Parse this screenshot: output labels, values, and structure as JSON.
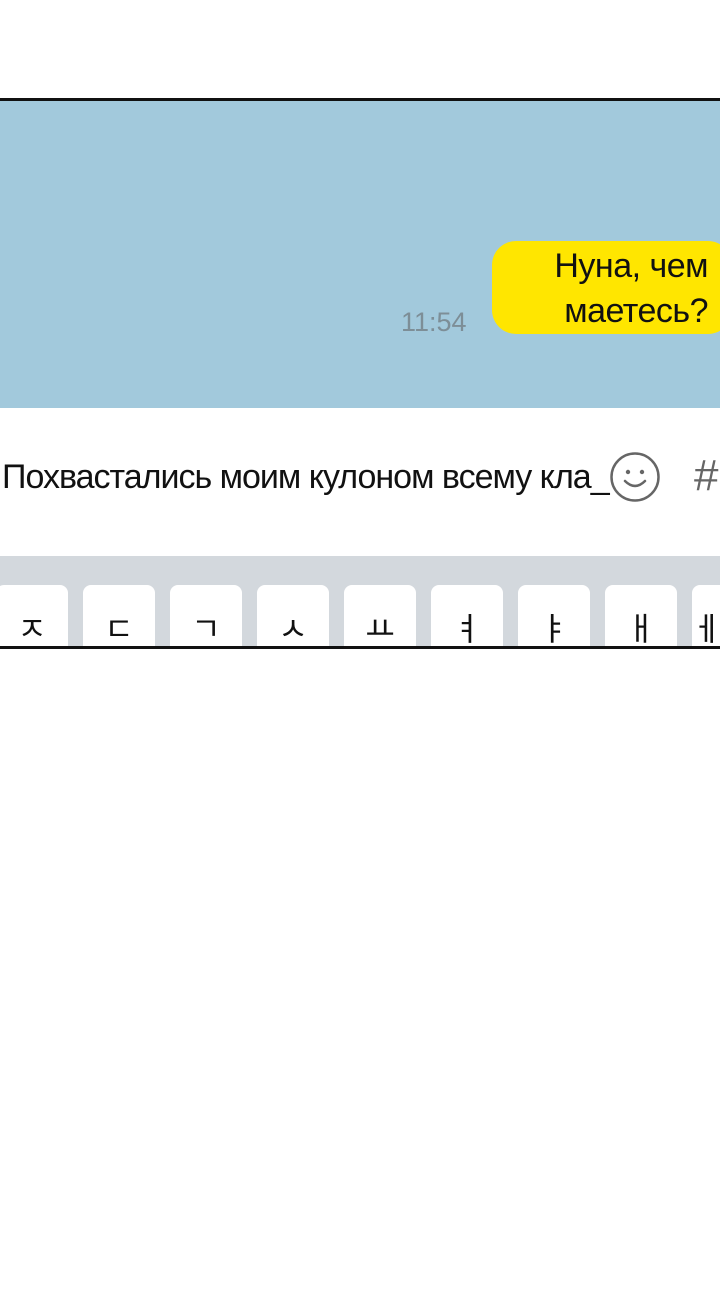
{
  "chat": {
    "message": {
      "line1": "Нуна, чем",
      "line2": "маетесь?",
      "time": "11:54"
    }
  },
  "input": {
    "text": "Похвастались моим кулоном всему кла_",
    "emoji_icon": "smiley-icon",
    "hash_label": "#"
  },
  "keyboard": {
    "keys": [
      "ㅈ",
      "ㄷ",
      "ㄱ",
      "ㅅ",
      "ㅛ",
      "ㅕ",
      "ㅑ",
      "ㅐ",
      "ㅔ"
    ]
  },
  "colors": {
    "chat_background": "#a2c9dc",
    "bubble": "#ffe600",
    "keyboard_background": "#d3d8dd"
  }
}
